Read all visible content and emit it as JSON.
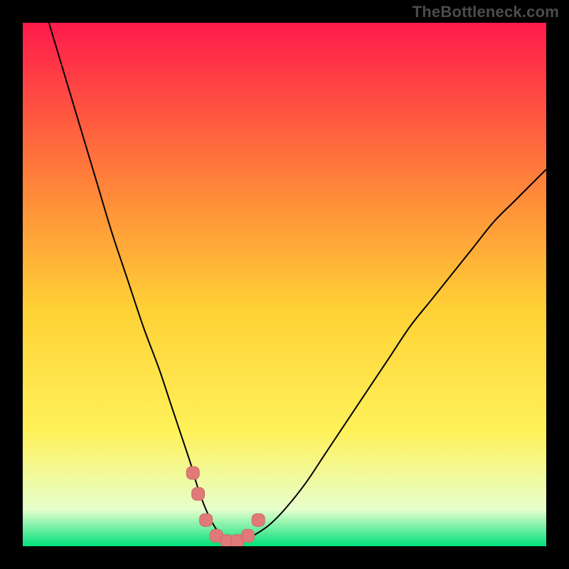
{
  "watermark": "TheBottleneck.com",
  "colors": {
    "frame": "#000000",
    "gradient_top": "#ff1a4b",
    "gradient_mid_upper": "#ff7a3a",
    "gradient_mid": "#ffd236",
    "gradient_mid_lower": "#fff15a",
    "gradient_near_bottom": "#e6ffcc",
    "gradient_bottom": "#00e07a",
    "curve": "#000000",
    "marker_fill": "#e07a78",
    "marker_stroke": "#cf6a68"
  },
  "chart_data": {
    "type": "line",
    "title": "",
    "xlabel": "",
    "ylabel": "",
    "xlim": [
      0,
      100
    ],
    "ylim": [
      0,
      100
    ],
    "curve": {
      "x": [
        5,
        8,
        11,
        14,
        17,
        20,
        23,
        26,
        28,
        30,
        32,
        33.5,
        35,
        36.5,
        38,
        40,
        42,
        44,
        47,
        50,
        54,
        58,
        62,
        66,
        70,
        74,
        78,
        82,
        86,
        90,
        94,
        98,
        100
      ],
      "y": [
        100,
        90,
        80,
        70,
        60,
        51,
        42,
        34,
        28,
        22,
        16,
        11,
        7,
        4,
        2,
        1,
        1,
        2,
        4,
        7,
        12,
        18,
        24,
        30,
        36,
        42,
        47,
        52,
        57,
        62,
        66,
        70,
        72
      ]
    },
    "markers": {
      "x": [
        32.5,
        33.5,
        35,
        37,
        39,
        41,
        43,
        45
      ],
      "y": [
        14,
        10,
        5,
        2,
        1,
        1,
        2,
        5
      ]
    }
  }
}
